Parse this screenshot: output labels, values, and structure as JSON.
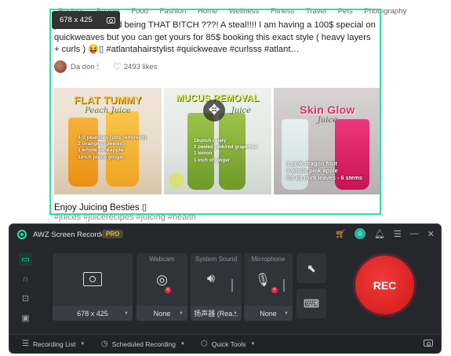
{
  "webpage": {
    "nav": [
      "Recipes",
      "Beauty",
      "Food",
      "Fashion",
      "Home",
      "Wellness",
      "Fitness",
      "Travel",
      "Pets",
      "Photography"
    ],
    "post_text": "y we walk around being THAT B!TCH ???! A steal!!!! I am having a 100$ special on quickweaves but you can get yours for 85$ booking this exact style ( heavy layers + curls ) 😝▯ #atlantahairstylist #quickweave #curlsss #atlant…",
    "author": "Da don 🕯",
    "likes": "2493 likes",
    "tiles": [
      {
        "title": "FLAT TUMMY",
        "subtitle": "Peach Juice",
        "lines": [
          "4-5 peaches (pits removed)",
          "2 oranges (peeled)",
          "1 whole pineapple",
          "1inch piece ginger"
        ]
      },
      {
        "title": "MUCUS REMOVAL",
        "subtitle": "Juice",
        "lines": [
          "1bunch celery",
          "1 peeled pink/red grapefruit",
          "1 lemon",
          "1 inch of ginger"
        ]
      },
      {
        "title": "Skin Glow",
        "subtitle": "Juice",
        "lines": [
          "1 pink dragon fruit",
          "1 whole pink apple",
          "0.5 oz mint leaves - 6 stems"
        ]
      }
    ],
    "caption": "Enjoy Juicing Besties ▯",
    "hashtags": "#juices #juicerecipes #juicing #health"
  },
  "selection": {
    "size": "678 x 425",
    "frame_color": "#2ee0a0"
  },
  "recorder": {
    "title": "AWZ Screen Recorder",
    "pro": "PRO",
    "panels": {
      "screen": {
        "value": "678 x 425"
      },
      "webcam": {
        "label": "Webcam",
        "value": "None"
      },
      "system_sound": {
        "label": "System Sound",
        "value": "扬声器 (Rea..."
      },
      "microphone": {
        "label": "Microphone",
        "value": "None"
      }
    },
    "rec_label": "REC",
    "bottom": {
      "recording_list": "Recording List",
      "scheduled_recording": "Scheduled Recording",
      "quick_tools": "Quick Tools"
    },
    "colors": {
      "accent": "#2ee0a0",
      "rec": "#e0201f",
      "window_bg": "#25272d"
    }
  }
}
